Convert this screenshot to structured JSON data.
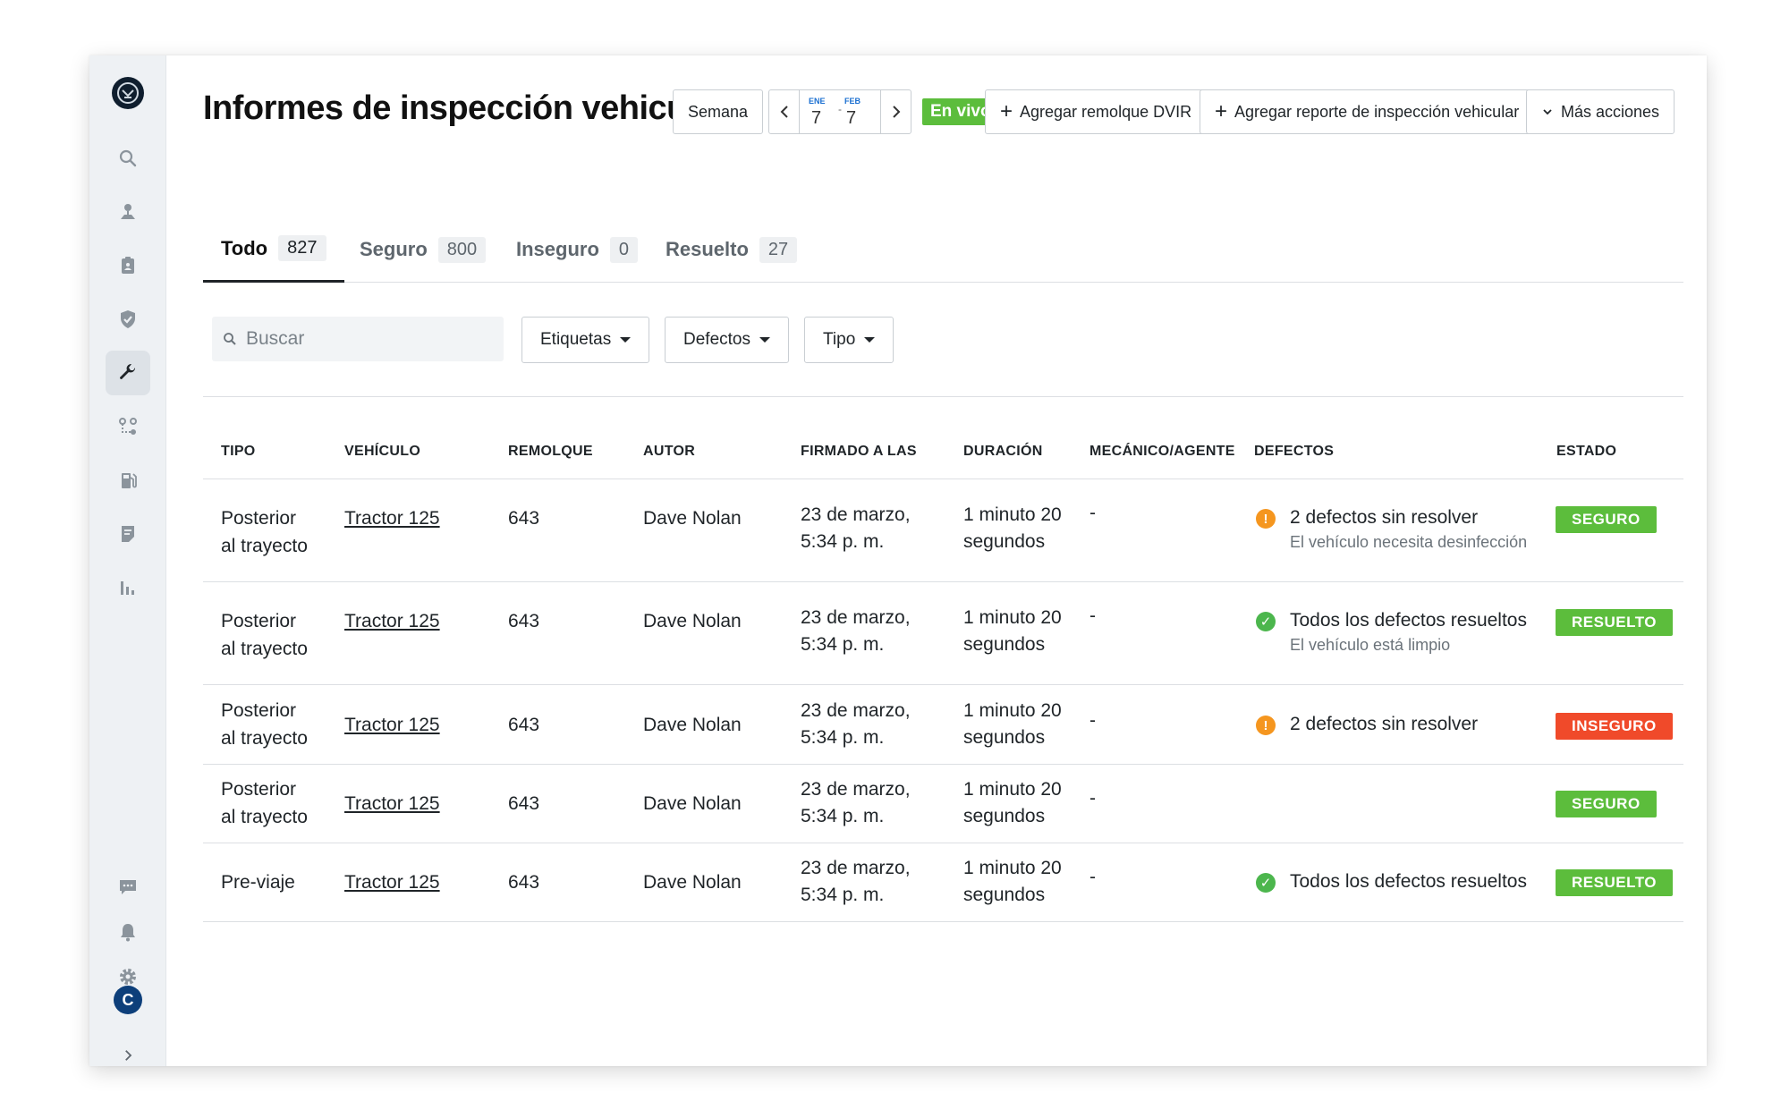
{
  "page": {
    "title": "Informes de inspección vehicular"
  },
  "toolbar": {
    "period_label": "Semana",
    "date_range": {
      "start_month": "ENE",
      "start_day": "7",
      "end_month": "FEB",
      "end_day": "7",
      "separator": "-"
    },
    "live_label": "En vivo",
    "add_trailer_label": "Agregar remolque DVIR",
    "add_report_label": "Agregar reporte de inspección vehicular",
    "more_actions_label": "Más acciones"
  },
  "tabs": [
    {
      "label": "Todo",
      "count": "827",
      "active": true
    },
    {
      "label": "Seguro",
      "count": "800"
    },
    {
      "label": "Inseguro",
      "count": "0"
    },
    {
      "label": "Resuelto",
      "count": "27"
    }
  ],
  "filters": {
    "search_placeholder": "Buscar",
    "tags_label": "Etiquetas",
    "defects_label": "Defectos",
    "type_label": "Tipo"
  },
  "table": {
    "headers": {
      "type": "TIPO",
      "vehicle": "VEHÍCULO",
      "trailer": "REMOLQUE",
      "author": "AUTOR",
      "signed_at": "FIRMADO A LAS",
      "duration": "DURACIÓN",
      "mechanic": "MECÁNICO/AGENTE",
      "defects": "DEFECTOS",
      "status": "ESTADO"
    },
    "rows": [
      {
        "type_line1": "Posterior",
        "type_line2": "al trayecto",
        "vehicle": "Tractor 125",
        "trailer": "643",
        "author": "Dave Nolan",
        "signed_line1": "23 de marzo,",
        "signed_line2": "5:34 p. m.",
        "duration_line1": "1 minuto 20",
        "duration_line2": "segundos",
        "mechanic": "-",
        "defect_icon": "warning-icon",
        "defect_text": "2 defectos sin resolver",
        "defect_note": "El vehículo necesita desinfección",
        "status": "SEGURO",
        "status_color": "#5cbd3c"
      },
      {
        "type_line1": "Posterior",
        "type_line2": "al trayecto",
        "vehicle": "Tractor 125",
        "trailer": "643",
        "author": "Dave Nolan",
        "signed_line1": "23 de marzo,",
        "signed_line2": "5:34 p. m.",
        "duration_line1": "1 minuto 20",
        "duration_line2": "segundos",
        "mechanic": "-",
        "defect_icon": "check-circle-icon",
        "defect_text": "Todos los defectos resueltos",
        "defect_note": "El vehículo está limpio",
        "status": "RESUELTO",
        "status_color": "#5cbd3c"
      },
      {
        "type_line1": "Posterior",
        "type_line2": "al trayecto",
        "vehicle": "Tractor 125",
        "trailer": "643",
        "author": "Dave Nolan",
        "signed_line1": "23 de marzo,",
        "signed_line2": "5:34 p. m.",
        "duration_line1": "1 minuto 20",
        "duration_line2": "segundos",
        "mechanic": "-",
        "defect_icon": "warning-icon",
        "defect_text": "2 defectos sin resolver",
        "defect_note": "",
        "status": "INSEGURO",
        "status_color": "#f04a2a"
      },
      {
        "type_line1": "Posterior",
        "type_line2": "al trayecto",
        "vehicle": "Tractor 125",
        "trailer": "643",
        "author": "Dave Nolan",
        "signed_line1": "23 de marzo,",
        "signed_line2": "5:34 p. m.",
        "duration_line1": "1 minuto 20",
        "duration_line2": "segundos",
        "mechanic": "-",
        "defect_icon": "",
        "defect_text": "",
        "defect_note": "",
        "status": "SEGURO",
        "status_color": "#5cbd3c"
      },
      {
        "type_line1": "Pre-viaje",
        "type_line2": "",
        "vehicle": "Tractor 125",
        "trailer": "643",
        "author": "Dave Nolan",
        "signed_line1": "23 de marzo,",
        "signed_line2": "5:34 p. m.",
        "duration_line1": "1 minuto 20",
        "duration_line2": "segundos",
        "mechanic": "-",
        "defect_icon": "check-circle-icon",
        "defect_text": "Todos los defectos resueltos",
        "defect_note": "",
        "status": "RESUELTO",
        "status_color": "#5cbd3c"
      }
    ]
  },
  "sidebar": {
    "icons": [
      "search-icon",
      "map-pin-icon",
      "clipboard-icon",
      "shield-check-icon",
      "wrench-icon",
      "route-icon",
      "fuel-icon",
      "document-icon",
      "bar-chart-icon"
    ],
    "active": "wrench-icon",
    "bottom_icons": [
      "chat-icon",
      "bell-icon",
      "gear-icon",
      "chevron-right-icon"
    ],
    "avatar_initial": "C"
  },
  "colors": {
    "safe": "#5cbd3c",
    "unsafe": "#f04a2a",
    "warning": "#f5961f",
    "ok": "#4cb64d",
    "accent": "#1a6fd1"
  }
}
